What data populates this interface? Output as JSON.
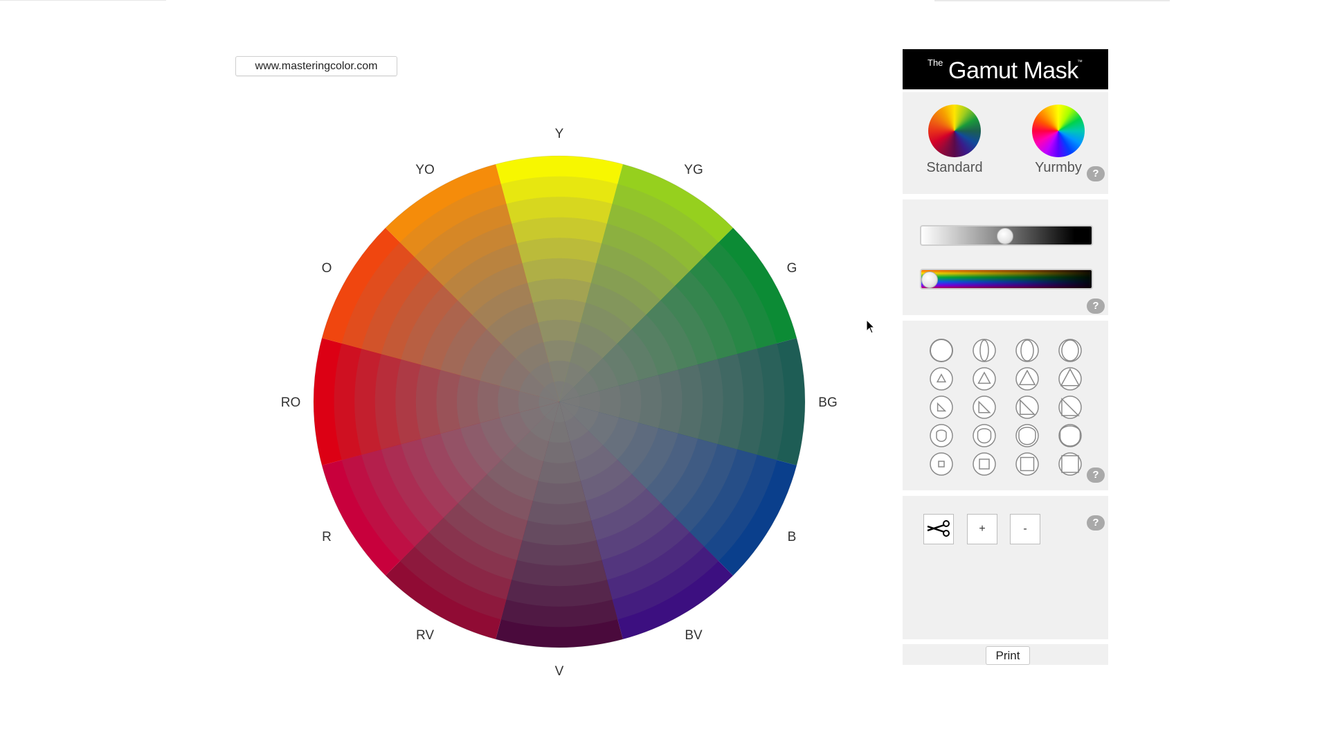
{
  "site": {
    "url": "www.masteringcolor.com"
  },
  "wheel": {
    "labels": [
      "Y",
      "YG",
      "G",
      "BG",
      "B",
      "BV",
      "V",
      "RV",
      "R",
      "RO",
      "O",
      "YO"
    ],
    "colors": [
      "#f7f700",
      "#96d01e",
      "#0c8b35",
      "#1e5d55",
      "#0a3f8c",
      "#3c0f80",
      "#4a0a3c",
      "#900b34",
      "#c8003c",
      "#dc0014",
      "#f0460f",
      "#f58c0a"
    ],
    "center_color": "#7a7a7a",
    "rings": 12
  },
  "panel": {
    "header": {
      "the": "The",
      "title": "Gamut Mask",
      "tm": "™"
    },
    "modes": {
      "standard_label": "Standard",
      "yurmby_label": "Yurmby"
    },
    "help_label": "?",
    "sliders": {
      "gray_value": 0.49,
      "hue_value": 0.0
    },
    "shape_icons": [
      [
        "circle-icon",
        "lens-narrow-icon",
        "lens-medium-icon",
        "lens-wide-icon"
      ],
      [
        "triangle-small-icon",
        "triangle-medium-icon",
        "triangle-large-icon",
        "triangle-xlarge-icon"
      ],
      [
        "right-triangle-small-icon",
        "right-triangle-medium-icon",
        "right-triangle-large-icon",
        "right-triangle-xlarge-icon"
      ],
      [
        "arch-small-icon",
        "arch-medium-icon",
        "arch-large-icon",
        "arch-xlarge-icon"
      ],
      [
        "square-small-icon",
        "square-medium-icon",
        "square-large-icon",
        "square-xlarge-icon"
      ]
    ],
    "tools": {
      "cut_icon": "scissors-icon",
      "add_label": "+",
      "remove_label": "-"
    },
    "print_label": "Print"
  }
}
